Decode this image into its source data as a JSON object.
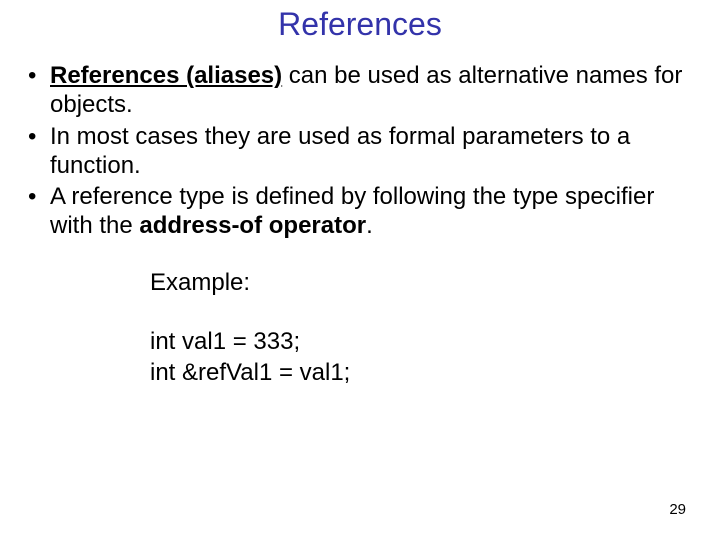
{
  "title": "References",
  "bullets": {
    "b1": {
      "strong": "References (aliases)",
      "rest": " can be used as alternative names for objects."
    },
    "b2": "In most cases they are used as formal parameters to a function.",
    "b3": {
      "pre": "A reference type is defined by following the type specifier with the ",
      "strong": "address-of operator",
      "post": "."
    }
  },
  "example": {
    "label": "Example:",
    "line1": "int val1 = 333;",
    "line2": "int &refVal1 = val1;"
  },
  "page_number": "29"
}
